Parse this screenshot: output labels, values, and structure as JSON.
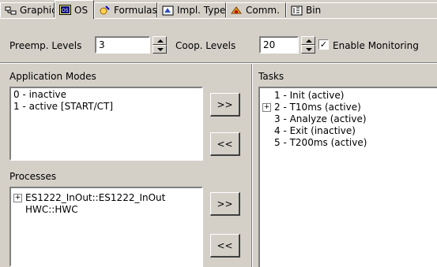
{
  "tabs": [
    {
      "label": "Graphics",
      "icon": "graphics-icon",
      "active": false
    },
    {
      "label": "OS",
      "icon": "os-icon",
      "active": true
    },
    {
      "label": "Formulas",
      "icon": "formulas-icon",
      "active": false
    },
    {
      "label": "Impl. Type",
      "icon": "impl-type-icon",
      "active": false
    },
    {
      "label": "Comm.",
      "icon": "comm-icon",
      "active": false
    },
    {
      "label": "Bin",
      "icon": "binary-icon",
      "active": false
    }
  ],
  "toolbar": {
    "preemp_label": "Preemp. Levels",
    "preemp_value": "3",
    "coop_label": "Coop. Levels",
    "coop_value": "20",
    "enable_monitoring_label": "Enable Monitoring",
    "enable_monitoring_checked": true
  },
  "application_modes": {
    "label": "Application Modes",
    "items": [
      "0 - inactive",
      "1 - active [START/CT]"
    ]
  },
  "processes": {
    "label": "Processes",
    "items": [
      {
        "text": "ES1222_InOut::ES1222_InOut",
        "expandable": true
      },
      {
        "text": "HWC::HWC",
        "expandable": false
      }
    ]
  },
  "tasks": {
    "label": "Tasks",
    "items": [
      {
        "text": "1 - Init (active)",
        "expandable": false
      },
      {
        "text": "2 - T10ms (active)",
        "expandable": true
      },
      {
        "text": "3 - Analyze (active)",
        "expandable": false
      },
      {
        "text": "4 - Exit (inactive)",
        "expandable": false
      },
      {
        "text": "5 - T200ms (active)",
        "expandable": false
      }
    ]
  },
  "buttons": {
    "add": ">>",
    "remove": "<<"
  },
  "colors": {
    "face": "#d4d0c8",
    "shadow": "#808080",
    "highlight": "#ffffff"
  }
}
